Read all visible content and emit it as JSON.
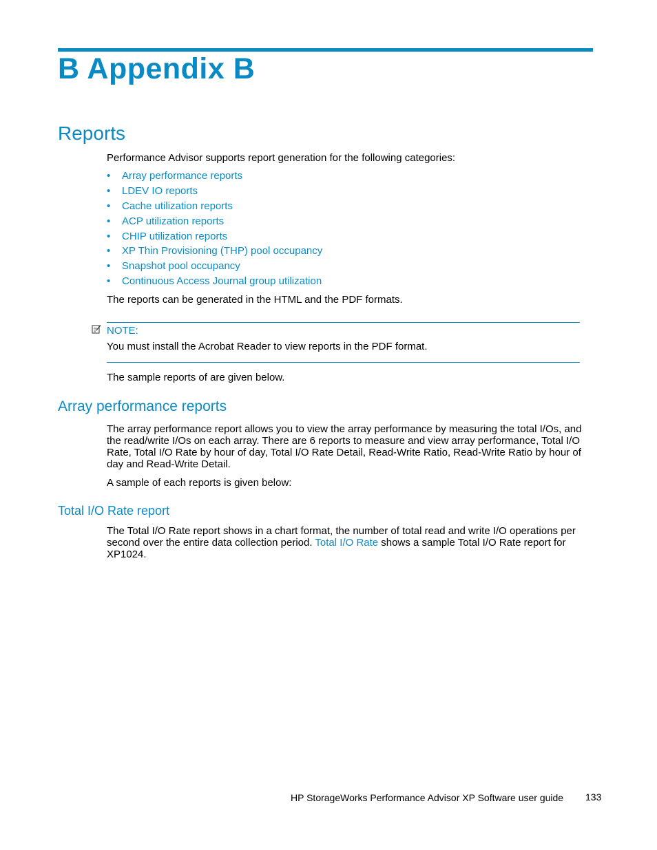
{
  "chapter": {
    "title": "B Appendix B"
  },
  "reports_section": {
    "heading": "Reports",
    "intro": "Performance Advisor supports report generation for the following categories:",
    "categories": [
      "Array performance reports",
      "LDEV IO reports",
      "Cache utilization reports",
      "ACP utilization reports",
      "CHIP utilization reports",
      "XP Thin Provisioning (THP) pool occupancy",
      "Snapshot pool occupancy",
      "Continuous Access Journal group utilization"
    ],
    "bullet": "•",
    "formats_text": "The reports can be generated in the HTML and the PDF formats.",
    "note": {
      "icon": "note-pencil-icon",
      "label": "NOTE:",
      "text": "You must install the Acrobat Reader to view reports in the PDF format."
    },
    "samples_text": "The sample reports of are given below."
  },
  "array_performance": {
    "heading": "Array performance reports",
    "paragraph": "The array performance report allows you to view the array performance by measuring the total I/Os, and the read/write I/Os on each array.  There are 6 reports to measure and view array performance, Total I/O Rate, Total I/O Rate by hour of day, Total I/O Rate Detail, Read-Write Ratio, Read-Write Ratio by hour of day and Read-Write Detail.",
    "sample_text": "A sample of each reports is given below:"
  },
  "total_io_rate": {
    "heading": "Total I/O Rate report",
    "text_before_link": "The Total I/O Rate report shows in a chart format, the number of total read and write I/O operations per second over the entire data collection period. ",
    "link_text": "Total I/O Rate",
    "text_after_link": " shows a sample Total I/O Rate report for XP1024."
  },
  "footer": {
    "guide_title": "HP StorageWorks Performance Advisor XP Software user guide",
    "page_number": "133"
  },
  "colors": {
    "accent": "#0a8ac4",
    "text": "#000000"
  }
}
